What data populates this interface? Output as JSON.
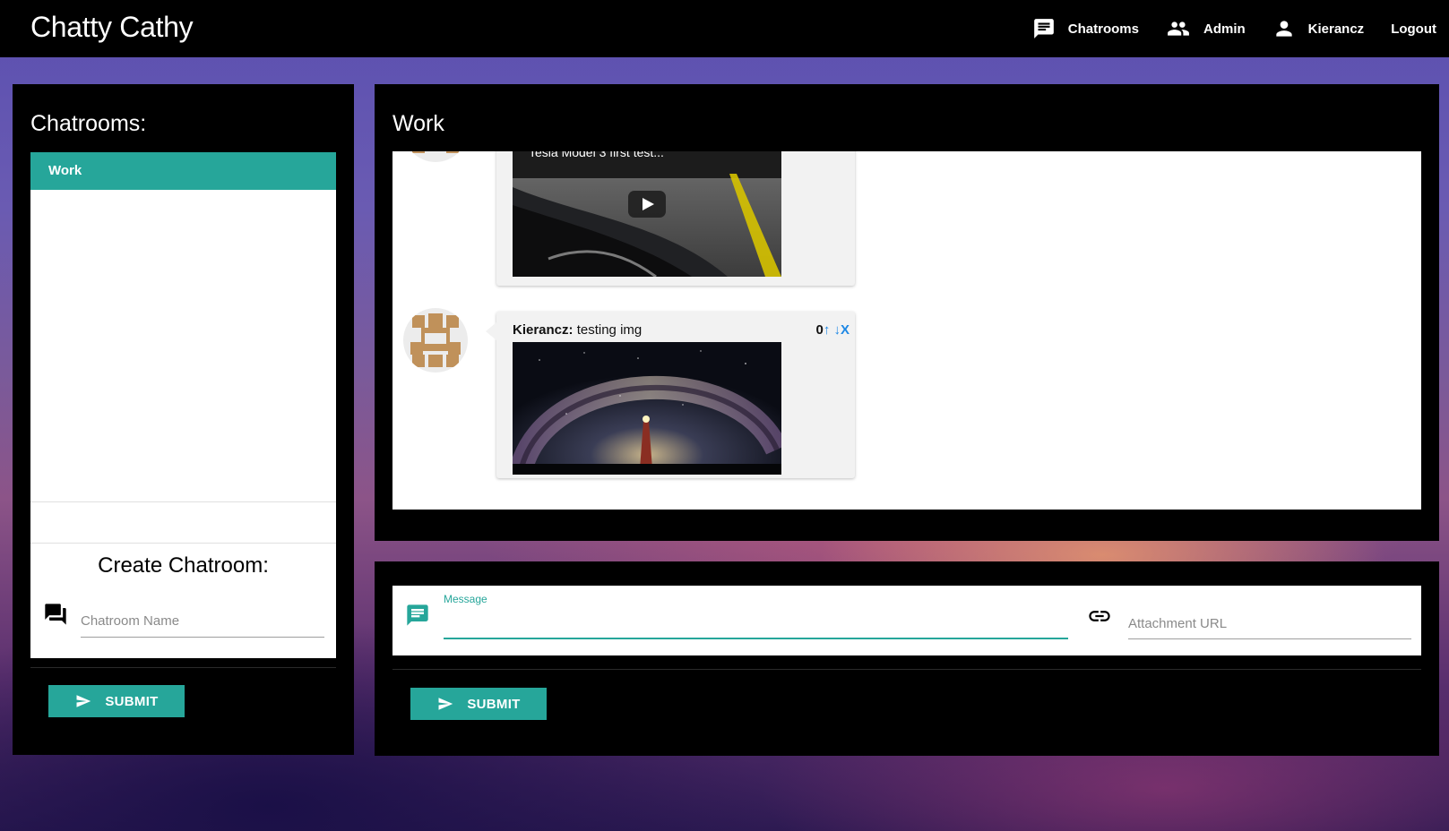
{
  "header": {
    "brand": "Chatty Cathy",
    "nav": [
      {
        "label": "Chatrooms",
        "icon": "chat-icon"
      },
      {
        "label": "Admin",
        "icon": "people-icon"
      },
      {
        "label": "Kierancz",
        "icon": "person-icon"
      },
      {
        "label": "Logout"
      }
    ]
  },
  "sidebar": {
    "title": "Chatrooms:",
    "rooms": [
      {
        "label": "Work",
        "active": true
      }
    ],
    "create": {
      "title": "Create Chatroom:",
      "input_placeholder": "Chatroom Name",
      "submit_label": "SUBMIT"
    }
  },
  "room": {
    "title": "Work",
    "messages": [
      {
        "author": "",
        "text": "",
        "media": {
          "type": "video",
          "title": "Tesla Model 3 first test...",
          "icon": "play-icon"
        }
      },
      {
        "author": "Kierancz:",
        "text": "testing img",
        "votes": {
          "count": "0",
          "up": "↑",
          "down": "↓",
          "remove": "X"
        },
        "media": {
          "type": "image",
          "description": "milky-way-lighthouse"
        }
      }
    ]
  },
  "composer": {
    "message_label": "Message",
    "message_value": "",
    "attachment_placeholder": "Attachment URL",
    "submit_label": "SUBMIT"
  },
  "colors": {
    "accent": "#26a69a",
    "vote_arrow": "#1e88e5",
    "avatar_brown": "#c0915a"
  }
}
